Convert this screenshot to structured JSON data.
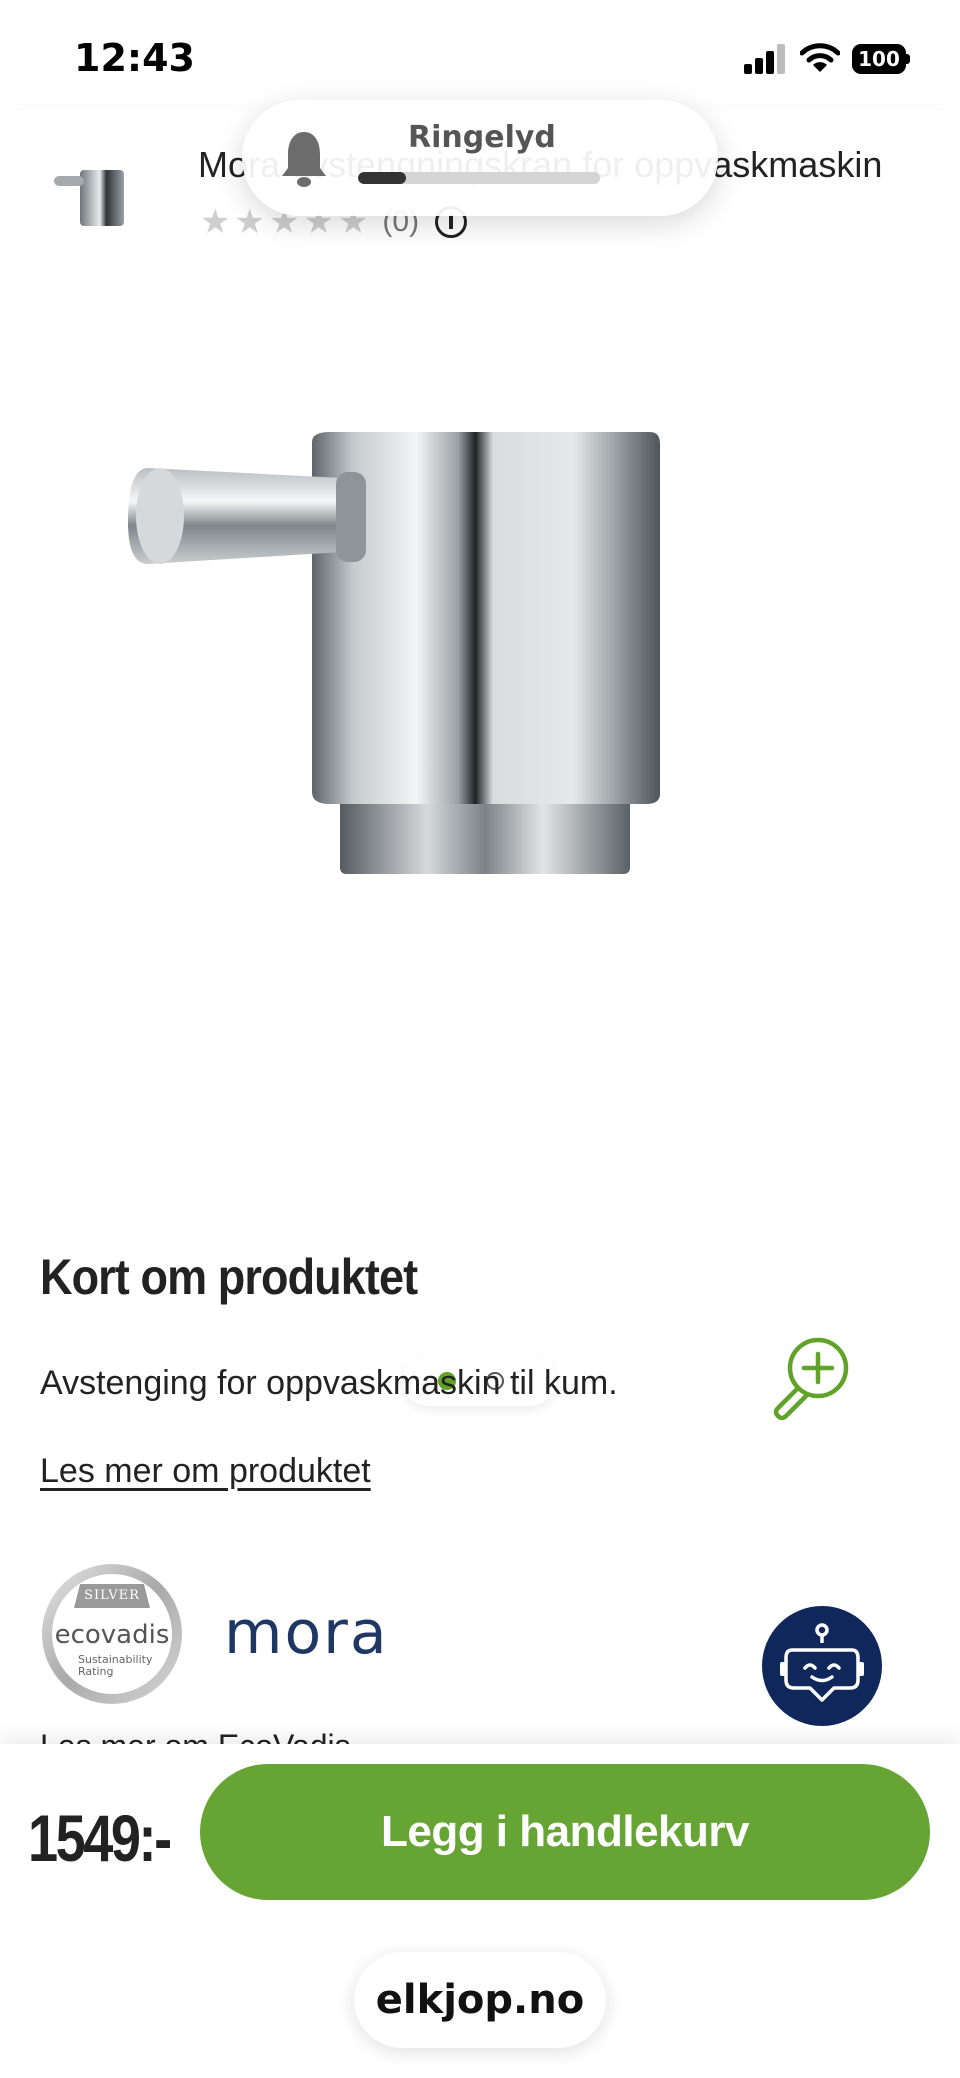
{
  "status_bar": {
    "time": "12:43",
    "battery": "100",
    "icons": [
      "cellular-signal-icon",
      "wifi-icon",
      "battery-icon"
    ]
  },
  "product_header": {
    "title": "Mora avstengningskran for oppvaskmaskin",
    "rating_stars": 0,
    "rating_count": "(0)"
  },
  "ringer_toast": {
    "label": "Ringelyd",
    "volume_fraction": 0.2
  },
  "gallery": {
    "current_slide": 1,
    "total_slides": 2
  },
  "description": {
    "heading": "Kort om produktet",
    "text": "Avstenging for oppvaskmaskin til kum.",
    "read_more": "Les mer om produktet"
  },
  "badges": {
    "ecovadis_silver": "SILVER",
    "ecovadis_word": "ecovadis",
    "ecovadis_sub1": "Sustainability",
    "ecovadis_sub2": "Rating",
    "brand_logo": "mora"
  },
  "partial_line": "Les mer om EcoVadis",
  "buy_bar": {
    "price": "1549:-",
    "add_to_cart": "Legg i handlekurv"
  },
  "browser": {
    "url": "elkjop.no"
  },
  "colors": {
    "accent_green": "#66a533",
    "dot_green": "#61a229",
    "chatbot_navy": "#10275b",
    "mora_blue": "#1f3763"
  }
}
